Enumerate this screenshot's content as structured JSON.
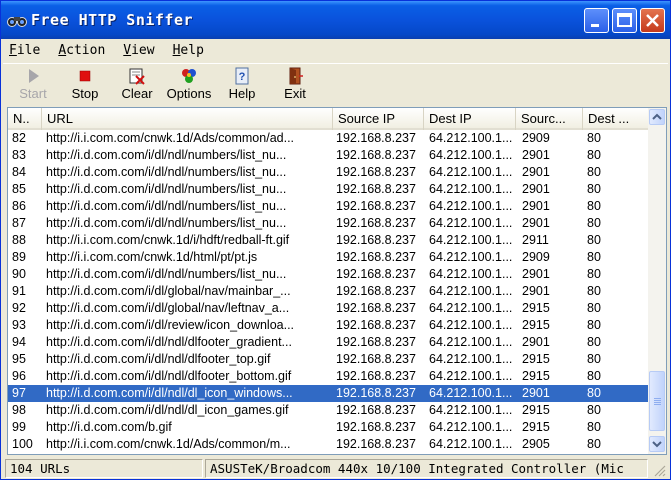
{
  "window": {
    "title": "Free HTTP Sniffer"
  },
  "menu": [
    {
      "hot": "F",
      "rest": "ile"
    },
    {
      "hot": "A",
      "rest": "ction"
    },
    {
      "hot": "V",
      "rest": "iew"
    },
    {
      "hot": "H",
      "rest": "elp"
    }
  ],
  "toolbar": {
    "start": {
      "label": "Start",
      "icon": "play-icon",
      "enabled": false
    },
    "stop": {
      "label": "Stop",
      "icon": "stop-icon"
    },
    "clear": {
      "label": "Clear",
      "icon": "clear-icon"
    },
    "options": {
      "label": "Options",
      "icon": "options-icon"
    },
    "help": {
      "label": "Help",
      "icon": "help-icon"
    },
    "exit": {
      "label": "Exit",
      "icon": "exit-door-icon"
    }
  },
  "columns": [
    "N..",
    "URL",
    "Source IP",
    "Dest IP",
    "Sourc...",
    "Dest ..."
  ],
  "selected_row": "97",
  "rows": [
    [
      "82",
      "http://i.i.com.com/cnwk.1d/Ads/common/ad...",
      "192.168.8.237",
      "64.212.100.1...",
      "2909",
      "80"
    ],
    [
      "83",
      "http://i.d.com.com/i/dl/ndl/numbers/list_nu...",
      "192.168.8.237",
      "64.212.100.1...",
      "2901",
      "80"
    ],
    [
      "84",
      "http://i.d.com.com/i/dl/ndl/numbers/list_nu...",
      "192.168.8.237",
      "64.212.100.1...",
      "2901",
      "80"
    ],
    [
      "85",
      "http://i.d.com.com/i/dl/ndl/numbers/list_nu...",
      "192.168.8.237",
      "64.212.100.1...",
      "2901",
      "80"
    ],
    [
      "86",
      "http://i.d.com.com/i/dl/ndl/numbers/list_nu...",
      "192.168.8.237",
      "64.212.100.1...",
      "2901",
      "80"
    ],
    [
      "87",
      "http://i.d.com.com/i/dl/ndl/numbers/list_nu...",
      "192.168.8.237",
      "64.212.100.1...",
      "2901",
      "80"
    ],
    [
      "88",
      "http://i.i.com.com/cnwk.1d/i/hdft/redball-ft.gif",
      "192.168.8.237",
      "64.212.100.1...",
      "2911",
      "80"
    ],
    [
      "89",
      "http://i.i.com.com/cnwk.1d/html/pt/pt.js",
      "192.168.8.237",
      "64.212.100.1...",
      "2909",
      "80"
    ],
    [
      "90",
      "http://i.d.com.com/i/dl/ndl/numbers/list_nu...",
      "192.168.8.237",
      "64.212.100.1...",
      "2901",
      "80"
    ],
    [
      "91",
      "http://i.d.com.com/i/dl/global/nav/mainbar_...",
      "192.168.8.237",
      "64.212.100.1...",
      "2901",
      "80"
    ],
    [
      "92",
      "http://i.d.com.com/i/dl/global/nav/leftnav_a...",
      "192.168.8.237",
      "64.212.100.1...",
      "2915",
      "80"
    ],
    [
      "93",
      "http://i.d.com.com/i/dl/review/icon_downloa...",
      "192.168.8.237",
      "64.212.100.1...",
      "2915",
      "80"
    ],
    [
      "94",
      "http://i.d.com.com/i/dl/ndl/dlfooter_gradient...",
      "192.168.8.237",
      "64.212.100.1...",
      "2901",
      "80"
    ],
    [
      "95",
      "http://i.d.com.com/i/dl/ndl/dlfooter_top.gif",
      "192.168.8.237",
      "64.212.100.1...",
      "2915",
      "80"
    ],
    [
      "96",
      "http://i.d.com.com/i/dl/ndl/dlfooter_bottom.gif",
      "192.168.8.237",
      "64.212.100.1...",
      "2915",
      "80"
    ],
    [
      "97",
      "http://i.d.com.com/i/dl/ndl/dl_icon_windows...",
      "192.168.8.237",
      "64.212.100.1...",
      "2901",
      "80"
    ],
    [
      "98",
      "http://i.d.com.com/i/dl/ndl/dl_icon_games.gif",
      "192.168.8.237",
      "64.212.100.1...",
      "2915",
      "80"
    ],
    [
      "99",
      "http://i.d.com.com/b.gif",
      "192.168.8.237",
      "64.212.100.1...",
      "2915",
      "80"
    ],
    [
      "100",
      "http://i.i.com.com/cnwk.1d/Ads/common/m...",
      "192.168.8.237",
      "64.212.100.1...",
      "2905",
      "80"
    ]
  ],
  "status": {
    "count": "104 URLs",
    "adapter": "ASUSTeK/Broadcom 440x 10/100 Integrated Controller (Mic"
  },
  "colors": {
    "titlebar": "#0a52dc",
    "selection": "#316ac5",
    "face": "#ece9d8"
  }
}
